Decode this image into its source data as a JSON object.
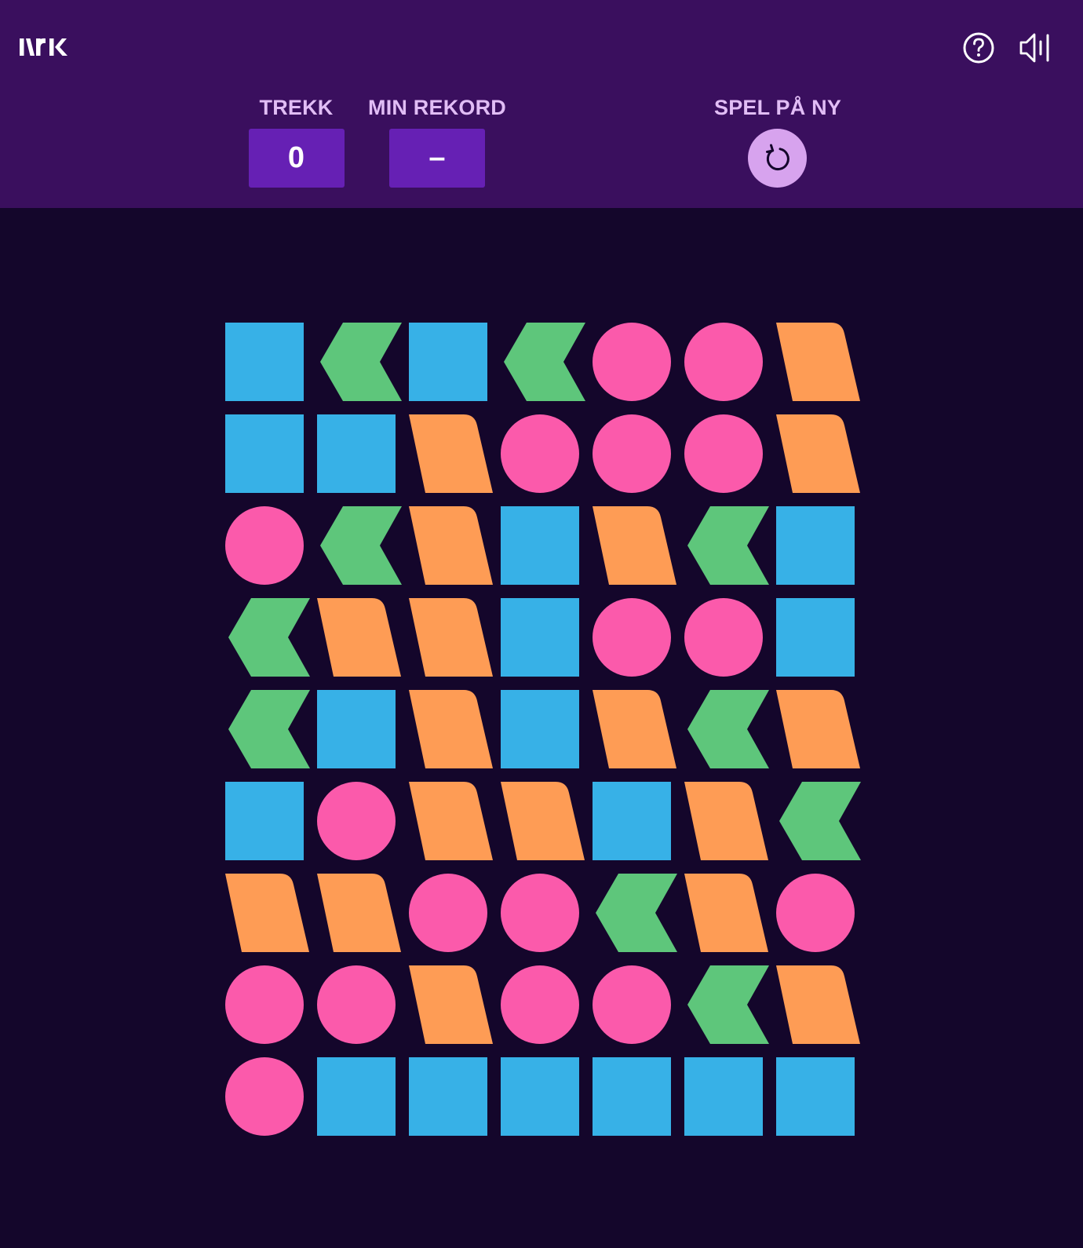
{
  "header": {
    "logo_text": "NRK",
    "help_icon": "question-circle-icon",
    "sound_icon": "speaker-icon",
    "background": "#3a0f5e"
  },
  "stats": {
    "moves_label": "TREKK",
    "moves_value": "0",
    "record_label": "MIN REKORD",
    "record_value": "–",
    "replay_label": "SPEL PÅ NY",
    "replay_icon": "restart-arrow-icon"
  },
  "colors": {
    "square": "#37b1e7",
    "chevron": "#5ec67b",
    "circle": "#fb5aab",
    "parallelogram": "#fe9c55",
    "board_bg": "#14062b",
    "stat_box": "#6620b4",
    "label": "#e1bdf5"
  },
  "board": {
    "rows": [
      [
        "square",
        "chevron",
        "square",
        "chevron",
        "circle",
        "circle",
        "parallelogram"
      ],
      [
        "square",
        "square",
        "parallelogram",
        "circle",
        "circle",
        "circle",
        "parallelogram"
      ],
      [
        "circle",
        "chevron",
        "parallelogram",
        "square",
        "parallelogram",
        "chevron",
        "square"
      ],
      [
        "chevron",
        "parallelogram",
        "parallelogram",
        "square",
        "circle",
        "circle",
        "square"
      ],
      [
        "chevron",
        "square",
        "parallelogram",
        "square",
        "parallelogram",
        "chevron",
        "parallelogram"
      ],
      [
        "square",
        "circle",
        "parallelogram",
        "parallelogram",
        "square",
        "parallelogram",
        "chevron"
      ],
      [
        "parallelogram",
        "parallelogram",
        "circle",
        "circle",
        "chevron",
        "parallelogram",
        "circle"
      ],
      [
        "circle",
        "circle",
        "parallelogram",
        "circle",
        "circle",
        "chevron",
        "parallelogram"
      ],
      [
        "circle",
        "square",
        "square",
        "square",
        "square",
        "square",
        "square"
      ]
    ]
  }
}
